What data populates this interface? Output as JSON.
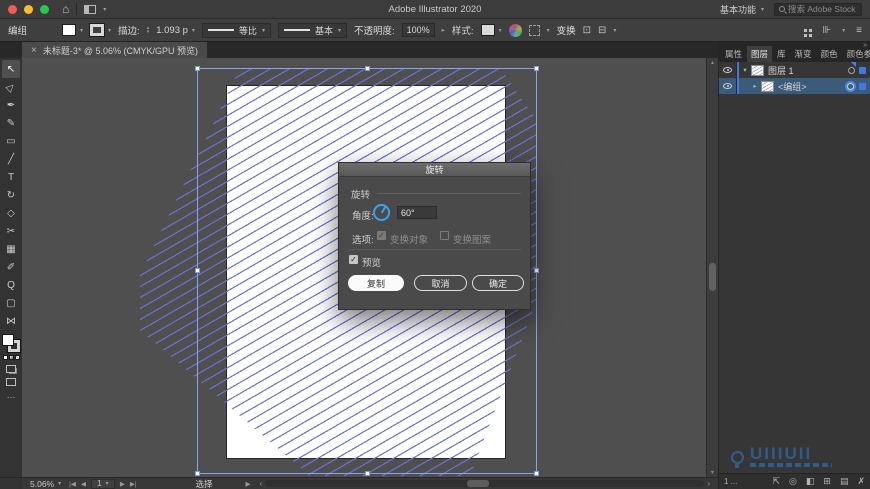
{
  "window": {
    "title": "Adobe Illustrator 2020",
    "workspace_switcher": "基本功能",
    "search_placeholder": "搜索 Adobe Stock"
  },
  "options_bar": {
    "context_label": "编组",
    "stroke_label": "描边:",
    "stroke_value": "1.093 p",
    "width_profile": "等比",
    "brush_definition": "基本",
    "opacity_label": "不透明度:",
    "opacity_value": "100%",
    "style_label": "样式:",
    "transform_label": "变换"
  },
  "doc_tab": {
    "close": "×",
    "title": "未标题-3* @ 5.06% (CMYK/GPU 预览)"
  },
  "tools": [
    {
      "name": "selection-tool",
      "glyph": "↖"
    },
    {
      "name": "direct-selection-tool",
      "glyph": "▷"
    },
    {
      "name": "pen-tool",
      "glyph": "✒"
    },
    {
      "name": "curvature-tool",
      "glyph": "✎"
    },
    {
      "name": "rectangle-tool",
      "glyph": "▭"
    },
    {
      "name": "line-segment-tool",
      "glyph": "╱"
    },
    {
      "name": "type-tool",
      "glyph": "T"
    },
    {
      "name": "rotate-tool",
      "glyph": "↻"
    },
    {
      "name": "eraser-tool",
      "glyph": "◇"
    },
    {
      "name": "scissors-tool",
      "glyph": "✂"
    },
    {
      "name": "gradient-tool",
      "glyph": "▦"
    },
    {
      "name": "eyedropper-tool",
      "glyph": "✐"
    },
    {
      "name": "zoom-tool",
      "glyph": "Q"
    },
    {
      "name": "artboard-tool",
      "glyph": "▢"
    },
    {
      "name": "width-tool",
      "glyph": "⋈"
    }
  ],
  "tools_more": "…",
  "dialog": {
    "title": "旋转",
    "section_label": "旋转",
    "angle_label": "角度:",
    "angle_value": "60°",
    "options_label": "选项:",
    "option_objects": "变换对象",
    "option_patterns": "变换图案",
    "preview_label": "预览",
    "copy_button": "复制",
    "cancel_button": "取消",
    "ok_button": "确定"
  },
  "layers_panel": {
    "collapse_glyph": "»",
    "tabs": [
      "属性",
      "图层",
      "库",
      "渐变",
      "颜色",
      "颜色参"
    ],
    "panel_menu": "≡",
    "rows": [
      {
        "name": "图层 1",
        "expander": "▾"
      },
      {
        "name": "<编组>",
        "expander": "▸"
      }
    ],
    "footer": {
      "count": "1 ...",
      "icons": [
        {
          "name": "collect-for-export-icon",
          "glyph": "⇱"
        },
        {
          "name": "locate-object-icon",
          "glyph": "◎"
        },
        {
          "name": "make-mask-icon",
          "glyph": "◧"
        },
        {
          "name": "new-sublayer-icon",
          "glyph": "⊞"
        },
        {
          "name": "new-layer-icon",
          "glyph": "▤"
        },
        {
          "name": "delete-layer-icon",
          "glyph": "✗"
        }
      ]
    }
  },
  "status_bar": {
    "zoom": "5.06%",
    "nav_first": "|◀",
    "nav_prev": "◀",
    "artboard_number": "1",
    "nav_next": "▶",
    "nav_last": "▶|",
    "status": "选择",
    "flyout": "▶",
    "scroll_left": "‹",
    "scroll_right": "›"
  },
  "watermark": {
    "text": "UIIIUII"
  },
  "colors": {
    "accent_blue": "#3f7bdc",
    "hatch_line": "#6a72d4",
    "selection_outline": "#8aa4e6",
    "dial_blue": "#3ba1ee",
    "traffic_red": "#f25c54",
    "traffic_yellow": "#fdbc2c",
    "traffic_green": "#2bc84a"
  }
}
